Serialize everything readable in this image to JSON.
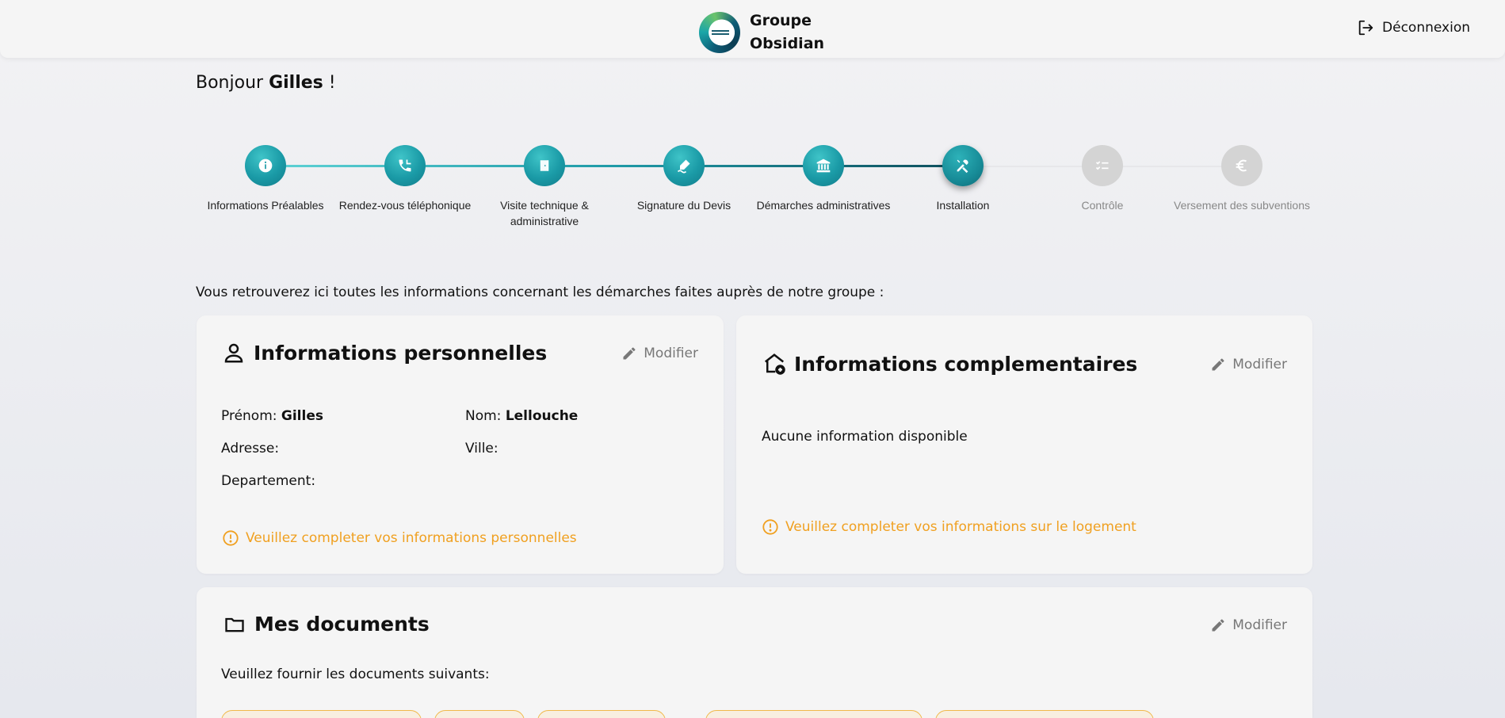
{
  "header": {
    "brand_line1": "Groupe",
    "brand_line2": "Obsidian",
    "logout_label": "Déconnexion"
  },
  "greeting": {
    "prefix": "Bonjour",
    "name": "Gilles",
    "suffix": "!"
  },
  "stepper": {
    "steps": [
      {
        "label": "Informations Préalables",
        "icon": "info-icon",
        "status": "done"
      },
      {
        "label": "Rendez-vous téléphonique",
        "icon": "phone-icon",
        "status": "done"
      },
      {
        "label": "Visite technique & administrative",
        "icon": "door-icon",
        "status": "done"
      },
      {
        "label": "Signature du Devis",
        "icon": "signature-icon",
        "status": "done"
      },
      {
        "label": "Démarches administratives",
        "icon": "bank-icon",
        "status": "done"
      },
      {
        "label": "Installation",
        "icon": "tools-icon",
        "status": "current"
      },
      {
        "label": "Contrôle",
        "icon": "checklist-icon",
        "status": "pending"
      },
      {
        "label": "Versement des subventions",
        "icon": "euro-icon",
        "status": "pending"
      }
    ]
  },
  "intro": "Vous retrouverez ici toutes les informations concernant les démarches faites auprès de notre groupe :",
  "personal": {
    "title": "Informations personnelles",
    "modify_label": "Modifier",
    "firstname_label": "Prénom:",
    "firstname_value": "Gilles",
    "lastname_label": "Nom:",
    "lastname_value": "Lellouche",
    "address_label": "Adresse:",
    "city_label": "Ville:",
    "department_label": "Departement:",
    "warning": "Veuillez completer vos informations personnelles"
  },
  "complementary": {
    "title": "Informations complementaires",
    "modify_label": "Modifier",
    "empty_text": "Aucune information disponible",
    "warning": "Veuillez completer vos informations sur le logement"
  },
  "documents": {
    "title": "Mes documents",
    "modify_label": "Modifier",
    "intro": "Veuillez fournir les documents suivants:"
  },
  "colors": {
    "accent": "#1a9aa6",
    "warning": "#f0a020",
    "pending": "#d4d4d4"
  }
}
